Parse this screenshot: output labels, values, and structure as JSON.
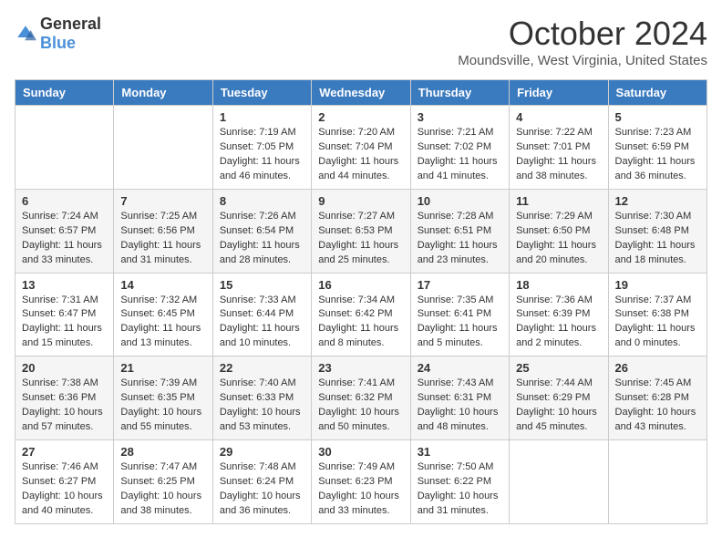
{
  "header": {
    "logo_general": "General",
    "logo_blue": "Blue",
    "month": "October 2024",
    "location": "Moundsville, West Virginia, United States"
  },
  "days_of_week": [
    "Sunday",
    "Monday",
    "Tuesday",
    "Wednesday",
    "Thursday",
    "Friday",
    "Saturday"
  ],
  "weeks": [
    [
      {
        "day": "",
        "sunrise": "",
        "sunset": "",
        "daylight": ""
      },
      {
        "day": "",
        "sunrise": "",
        "sunset": "",
        "daylight": ""
      },
      {
        "day": "1",
        "sunrise": "Sunrise: 7:19 AM",
        "sunset": "Sunset: 7:05 PM",
        "daylight": "Daylight: 11 hours and 46 minutes."
      },
      {
        "day": "2",
        "sunrise": "Sunrise: 7:20 AM",
        "sunset": "Sunset: 7:04 PM",
        "daylight": "Daylight: 11 hours and 44 minutes."
      },
      {
        "day": "3",
        "sunrise": "Sunrise: 7:21 AM",
        "sunset": "Sunset: 7:02 PM",
        "daylight": "Daylight: 11 hours and 41 minutes."
      },
      {
        "day": "4",
        "sunrise": "Sunrise: 7:22 AM",
        "sunset": "Sunset: 7:01 PM",
        "daylight": "Daylight: 11 hours and 38 minutes."
      },
      {
        "day": "5",
        "sunrise": "Sunrise: 7:23 AM",
        "sunset": "Sunset: 6:59 PM",
        "daylight": "Daylight: 11 hours and 36 minutes."
      }
    ],
    [
      {
        "day": "6",
        "sunrise": "Sunrise: 7:24 AM",
        "sunset": "Sunset: 6:57 PM",
        "daylight": "Daylight: 11 hours and 33 minutes."
      },
      {
        "day": "7",
        "sunrise": "Sunrise: 7:25 AM",
        "sunset": "Sunset: 6:56 PM",
        "daylight": "Daylight: 11 hours and 31 minutes."
      },
      {
        "day": "8",
        "sunrise": "Sunrise: 7:26 AM",
        "sunset": "Sunset: 6:54 PM",
        "daylight": "Daylight: 11 hours and 28 minutes."
      },
      {
        "day": "9",
        "sunrise": "Sunrise: 7:27 AM",
        "sunset": "Sunset: 6:53 PM",
        "daylight": "Daylight: 11 hours and 25 minutes."
      },
      {
        "day": "10",
        "sunrise": "Sunrise: 7:28 AM",
        "sunset": "Sunset: 6:51 PM",
        "daylight": "Daylight: 11 hours and 23 minutes."
      },
      {
        "day": "11",
        "sunrise": "Sunrise: 7:29 AM",
        "sunset": "Sunset: 6:50 PM",
        "daylight": "Daylight: 11 hours and 20 minutes."
      },
      {
        "day": "12",
        "sunrise": "Sunrise: 7:30 AM",
        "sunset": "Sunset: 6:48 PM",
        "daylight": "Daylight: 11 hours and 18 minutes."
      }
    ],
    [
      {
        "day": "13",
        "sunrise": "Sunrise: 7:31 AM",
        "sunset": "Sunset: 6:47 PM",
        "daylight": "Daylight: 11 hours and 15 minutes."
      },
      {
        "day": "14",
        "sunrise": "Sunrise: 7:32 AM",
        "sunset": "Sunset: 6:45 PM",
        "daylight": "Daylight: 11 hours and 13 minutes."
      },
      {
        "day": "15",
        "sunrise": "Sunrise: 7:33 AM",
        "sunset": "Sunset: 6:44 PM",
        "daylight": "Daylight: 11 hours and 10 minutes."
      },
      {
        "day": "16",
        "sunrise": "Sunrise: 7:34 AM",
        "sunset": "Sunset: 6:42 PM",
        "daylight": "Daylight: 11 hours and 8 minutes."
      },
      {
        "day": "17",
        "sunrise": "Sunrise: 7:35 AM",
        "sunset": "Sunset: 6:41 PM",
        "daylight": "Daylight: 11 hours and 5 minutes."
      },
      {
        "day": "18",
        "sunrise": "Sunrise: 7:36 AM",
        "sunset": "Sunset: 6:39 PM",
        "daylight": "Daylight: 11 hours and 2 minutes."
      },
      {
        "day": "19",
        "sunrise": "Sunrise: 7:37 AM",
        "sunset": "Sunset: 6:38 PM",
        "daylight": "Daylight: 11 hours and 0 minutes."
      }
    ],
    [
      {
        "day": "20",
        "sunrise": "Sunrise: 7:38 AM",
        "sunset": "Sunset: 6:36 PM",
        "daylight": "Daylight: 10 hours and 57 minutes."
      },
      {
        "day": "21",
        "sunrise": "Sunrise: 7:39 AM",
        "sunset": "Sunset: 6:35 PM",
        "daylight": "Daylight: 10 hours and 55 minutes."
      },
      {
        "day": "22",
        "sunrise": "Sunrise: 7:40 AM",
        "sunset": "Sunset: 6:33 PM",
        "daylight": "Daylight: 10 hours and 53 minutes."
      },
      {
        "day": "23",
        "sunrise": "Sunrise: 7:41 AM",
        "sunset": "Sunset: 6:32 PM",
        "daylight": "Daylight: 10 hours and 50 minutes."
      },
      {
        "day": "24",
        "sunrise": "Sunrise: 7:43 AM",
        "sunset": "Sunset: 6:31 PM",
        "daylight": "Daylight: 10 hours and 48 minutes."
      },
      {
        "day": "25",
        "sunrise": "Sunrise: 7:44 AM",
        "sunset": "Sunset: 6:29 PM",
        "daylight": "Daylight: 10 hours and 45 minutes."
      },
      {
        "day": "26",
        "sunrise": "Sunrise: 7:45 AM",
        "sunset": "Sunset: 6:28 PM",
        "daylight": "Daylight: 10 hours and 43 minutes."
      }
    ],
    [
      {
        "day": "27",
        "sunrise": "Sunrise: 7:46 AM",
        "sunset": "Sunset: 6:27 PM",
        "daylight": "Daylight: 10 hours and 40 minutes."
      },
      {
        "day": "28",
        "sunrise": "Sunrise: 7:47 AM",
        "sunset": "Sunset: 6:25 PM",
        "daylight": "Daylight: 10 hours and 38 minutes."
      },
      {
        "day": "29",
        "sunrise": "Sunrise: 7:48 AM",
        "sunset": "Sunset: 6:24 PM",
        "daylight": "Daylight: 10 hours and 36 minutes."
      },
      {
        "day": "30",
        "sunrise": "Sunrise: 7:49 AM",
        "sunset": "Sunset: 6:23 PM",
        "daylight": "Daylight: 10 hours and 33 minutes."
      },
      {
        "day": "31",
        "sunrise": "Sunrise: 7:50 AM",
        "sunset": "Sunset: 6:22 PM",
        "daylight": "Daylight: 10 hours and 31 minutes."
      },
      {
        "day": "",
        "sunrise": "",
        "sunset": "",
        "daylight": ""
      },
      {
        "day": "",
        "sunrise": "",
        "sunset": "",
        "daylight": ""
      }
    ]
  ]
}
